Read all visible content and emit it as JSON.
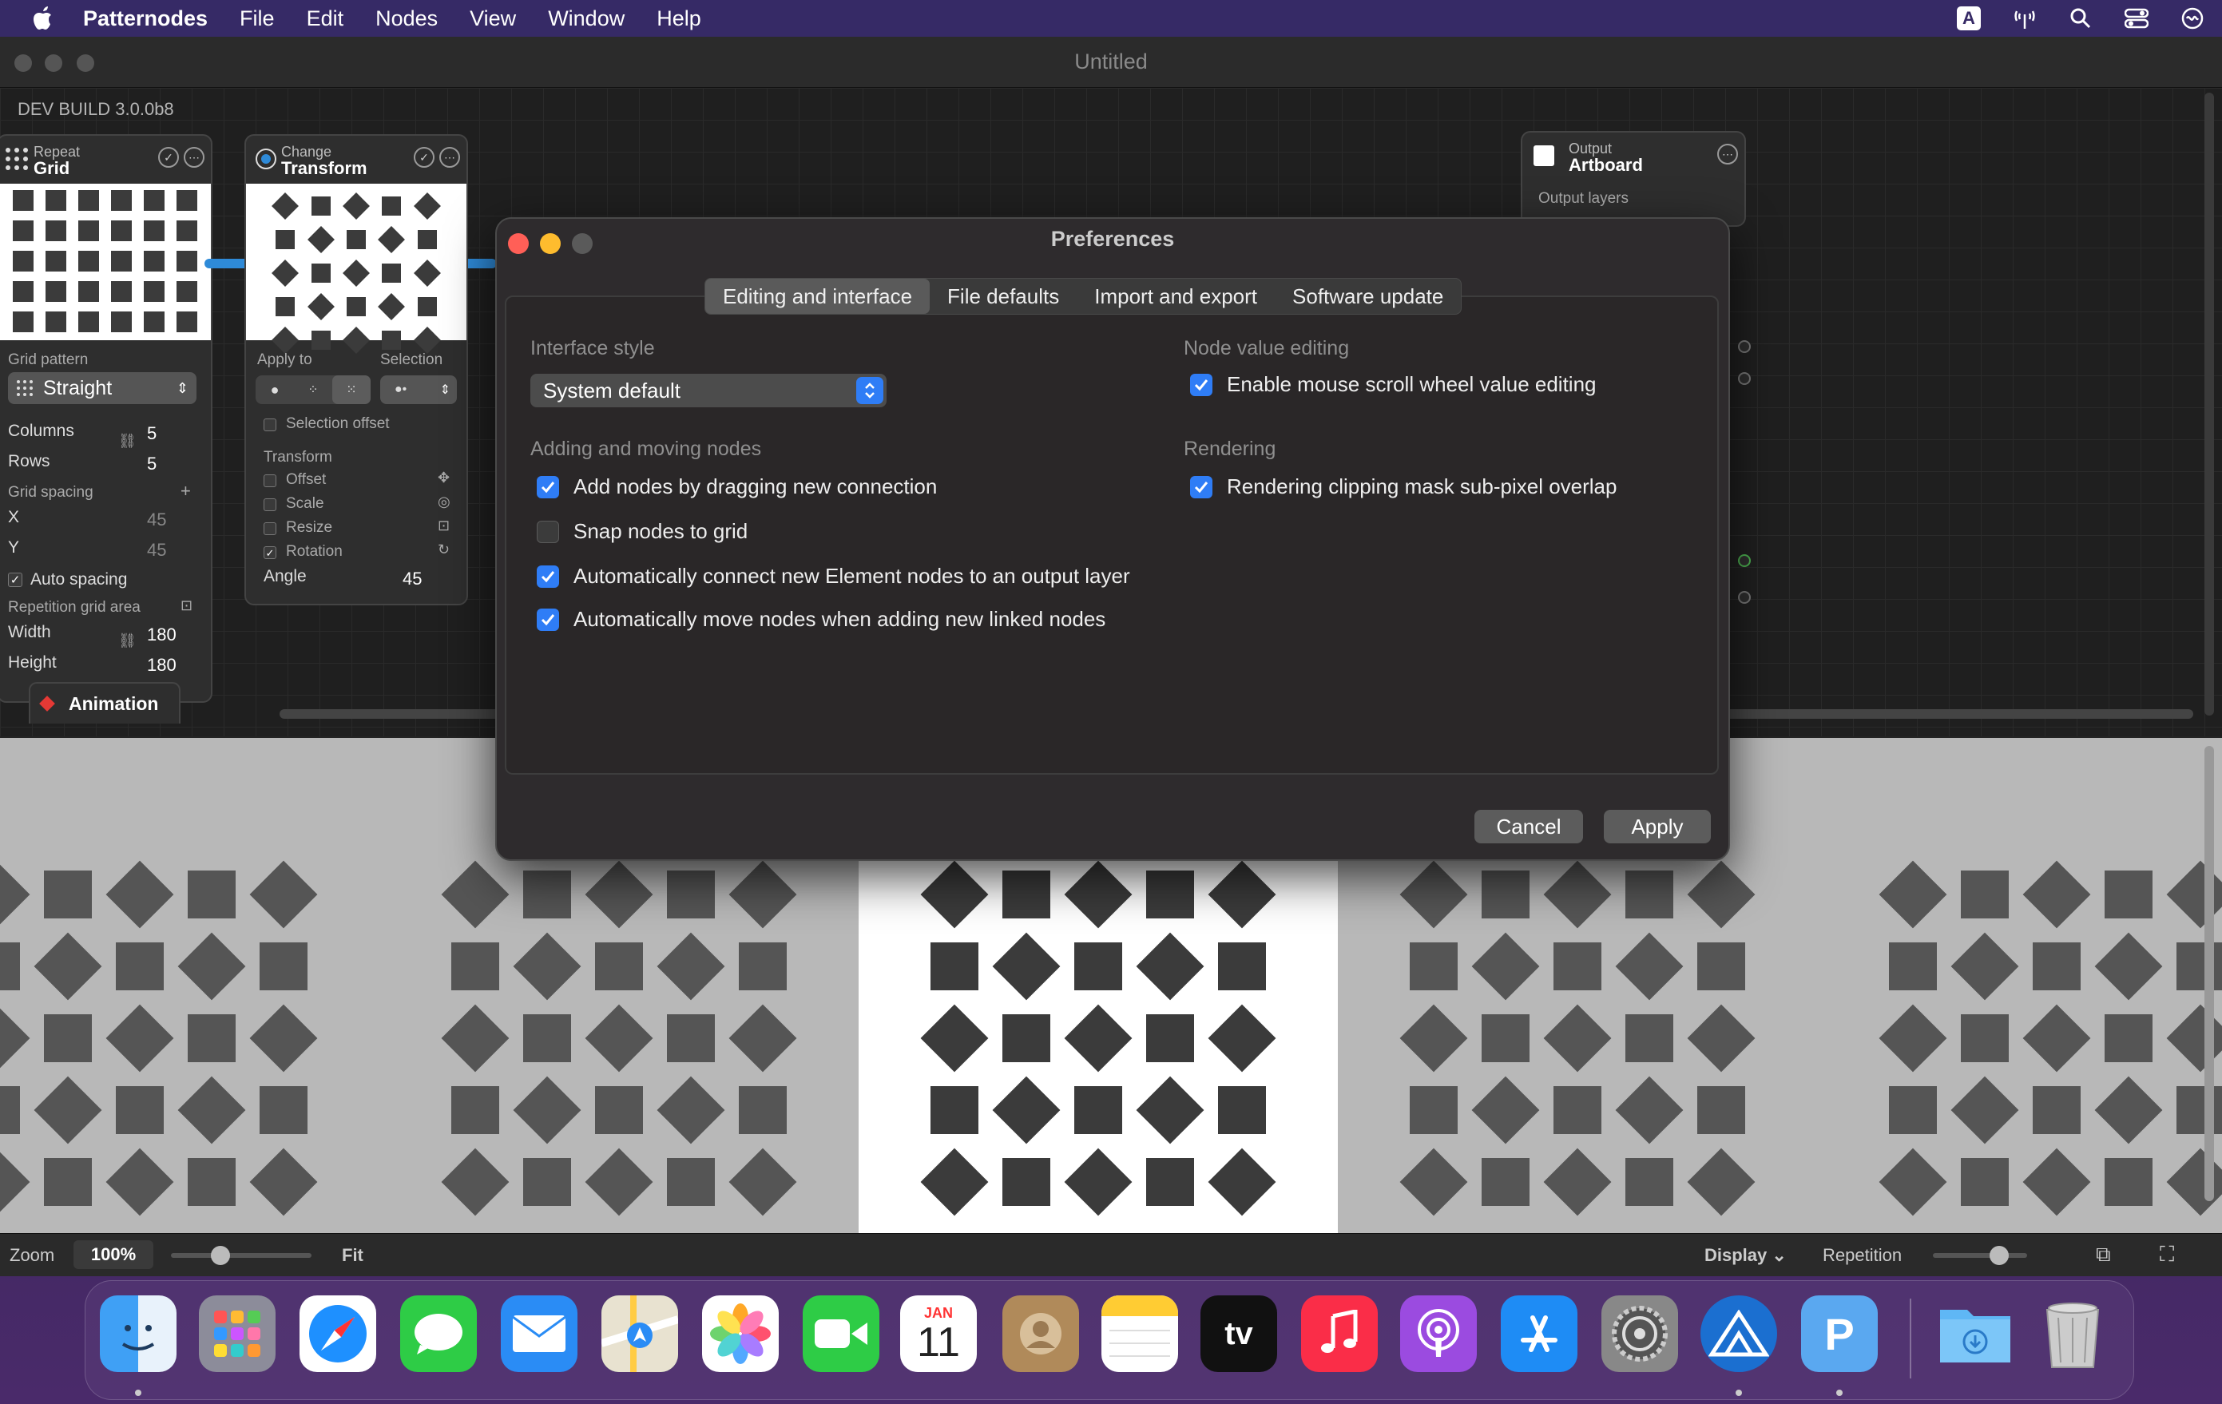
{
  "menubar": {
    "app_name": "Patternodes",
    "items": [
      "File",
      "Edit",
      "Nodes",
      "View",
      "Window",
      "Help"
    ],
    "status_icons": [
      "keyboard-a-icon",
      "antenna-icon",
      "search-icon",
      "control-center-icon",
      "siri-icon"
    ],
    "keyboard_letter": "A"
  },
  "window": {
    "title": "Untitled",
    "dev_build": "DEV BUILD 3.0.0b8"
  },
  "nodes": {
    "grid": {
      "subtitle": "Repeat",
      "title": "Grid",
      "pattern_label": "Grid pattern",
      "pattern_value": "Straight",
      "columns_label": "Columns",
      "columns_value": "5",
      "rows_label": "Rows",
      "rows_value": "5",
      "spacing_label": "Grid spacing",
      "x_label": "X",
      "x_value": "45",
      "y_label": "Y",
      "y_value": "45",
      "auto_spacing_label": "Auto spacing",
      "auto_spacing_checked": true,
      "area_label": "Repetition grid area",
      "width_label": "Width",
      "width_value": "180",
      "height_label": "Height",
      "height_value": "180"
    },
    "transform": {
      "subtitle": "Change",
      "title": "Transform",
      "apply_to_label": "Apply to",
      "selection_label": "Selection",
      "selection_offset_label": "Selection offset",
      "transform_label": "Transform",
      "offset_label": "Offset",
      "scale_label": "Scale",
      "resize_label": "Resize",
      "rotation_label": "Rotation",
      "rotation_checked": true,
      "angle_label": "Angle",
      "angle_value": "45"
    },
    "artboard": {
      "subtitle": "Output",
      "title": "Artboard",
      "output_label": "Output layers"
    }
  },
  "animation_tab": "Animation",
  "statusbar": {
    "zoom_label": "Zoom",
    "zoom_value": "100%",
    "zoom_slider_value": 0.35,
    "fit_label": "Fit",
    "display_label": "Display",
    "repetition_label": "Repetition",
    "repetition_slider_value": 0.7
  },
  "preferences": {
    "title": "Preferences",
    "tabs": [
      "Editing and interface",
      "File defaults",
      "Import and export",
      "Software update"
    ],
    "active_tab": 0,
    "interface_style_label": "Interface style",
    "interface_style_value": "System default",
    "adding_moving_label": "Adding and moving nodes",
    "left_options": [
      {
        "label": "Add nodes by dragging new connection",
        "checked": true
      },
      {
        "label": "Snap nodes to grid",
        "checked": false
      },
      {
        "label": "Automatically connect new Element nodes to an output layer",
        "checked": true
      },
      {
        "label": "Automatically move nodes when adding new linked nodes",
        "checked": true
      }
    ],
    "node_value_label": "Node value editing",
    "scroll_option": {
      "label": "Enable mouse scroll wheel value editing",
      "checked": true
    },
    "rendering_label": "Rendering",
    "rendering_option": {
      "label": "Rendering clipping mask sub-pixel overlap",
      "checked": true
    },
    "cancel_label": "Cancel",
    "apply_label": "Apply"
  },
  "colors": {
    "accent": "#2f7df6",
    "menubar": "#362a66",
    "close": "#ff5f57",
    "minimize": "#febc2e",
    "zoom": "#5a5a5a",
    "shape_dark": "#3b3b3b",
    "shape_canvas": "#555555"
  },
  "dock": {
    "apps": [
      "finder-icon",
      "launchpad-icon",
      "safari-icon",
      "messages-icon",
      "mail-icon",
      "maps-icon",
      "photos-icon",
      "facetime-icon",
      "calendar-icon",
      "contacts-icon",
      "notes-icon",
      "apple-tv-icon",
      "music-icon",
      "podcasts-icon",
      "app-store-icon",
      "system-settings-icon",
      "patternodes-icon",
      "pockity-icon",
      "downloads-folder-icon",
      "trash-icon"
    ],
    "calendar_month": "JAN",
    "calendar_day": "11",
    "tv_label": "tv",
    "p_letter": "P"
  }
}
